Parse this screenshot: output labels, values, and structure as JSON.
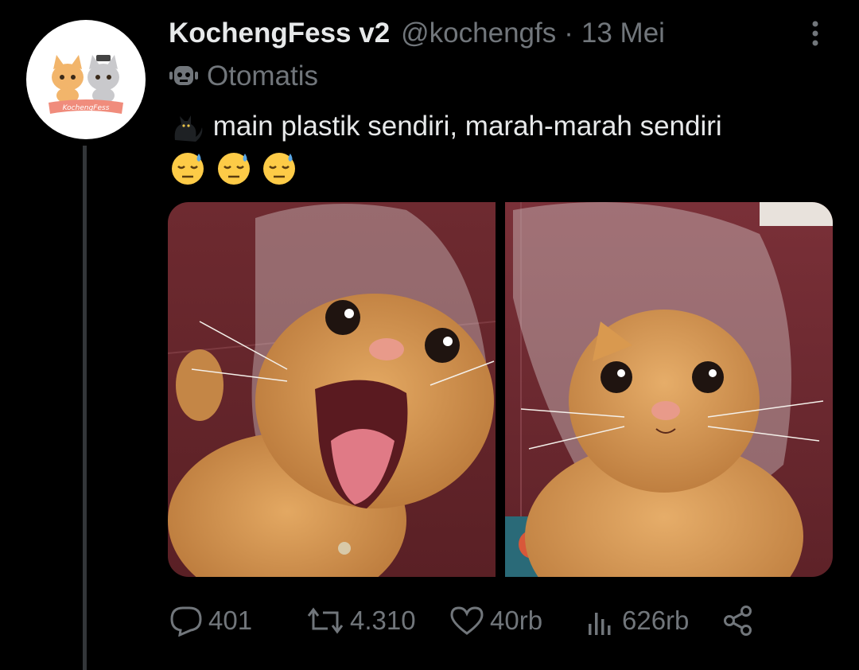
{
  "author": {
    "display_name": "KochengFess v2",
    "handle": "@kochengfs",
    "separator": "·",
    "date": "13 Mei",
    "avatar_text": "KochengFess"
  },
  "automated_label": "Otomatis",
  "tweet": {
    "text": "main plastik sendiri, marah-marah sendiri"
  },
  "media": {
    "count": 2,
    "photos": [
      "cat-photo-1",
      "cat-photo-2"
    ]
  },
  "actions": {
    "replies": "401",
    "retweets": "4.310",
    "likes": "40rb",
    "views": "626rb"
  },
  "icons": {
    "reply": "reply-icon",
    "retweet": "retweet-icon",
    "like": "heart-icon",
    "views": "analytics-icon",
    "share": "share-icon",
    "more": "more-options-icon",
    "automated": "robot-icon"
  },
  "colors": {
    "background": "#000000",
    "text_primary": "#e7e9ea",
    "text_secondary": "#71767b",
    "thread_line": "#333639"
  }
}
